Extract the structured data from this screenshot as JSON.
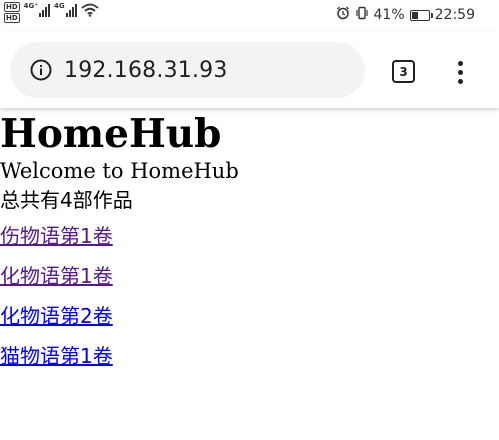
{
  "status_bar": {
    "hd_top": "HD",
    "hd_bottom": "HD",
    "net1": "4G⁺",
    "net2": "4G",
    "battery_percent": "41%",
    "battery_level": 0.41,
    "time": "22:59",
    "icons": [
      "alarm-icon",
      "vibrate-icon",
      "battery-icon",
      "wifi-icon",
      "signal-icon"
    ]
  },
  "browser": {
    "url": "192.168.31.93",
    "tab_count": "3",
    "icons": [
      "info-icon",
      "menu-icon"
    ]
  },
  "page": {
    "title": "HomeHub",
    "welcome": "Welcome to HomeHub",
    "count_text": "总共有4部作品",
    "works": [
      {
        "label": "伤物语第1卷",
        "visited": true
      },
      {
        "label": "化物语第1卷",
        "visited": true
      },
      {
        "label": "化物语第2卷",
        "visited": false
      },
      {
        "label": "猫物语第1卷",
        "visited": false
      }
    ]
  },
  "colors": {
    "visited_link": "#551a8b",
    "unvisited_link": "#0000ee",
    "address_bar_bg": "#f1f3f4"
  }
}
